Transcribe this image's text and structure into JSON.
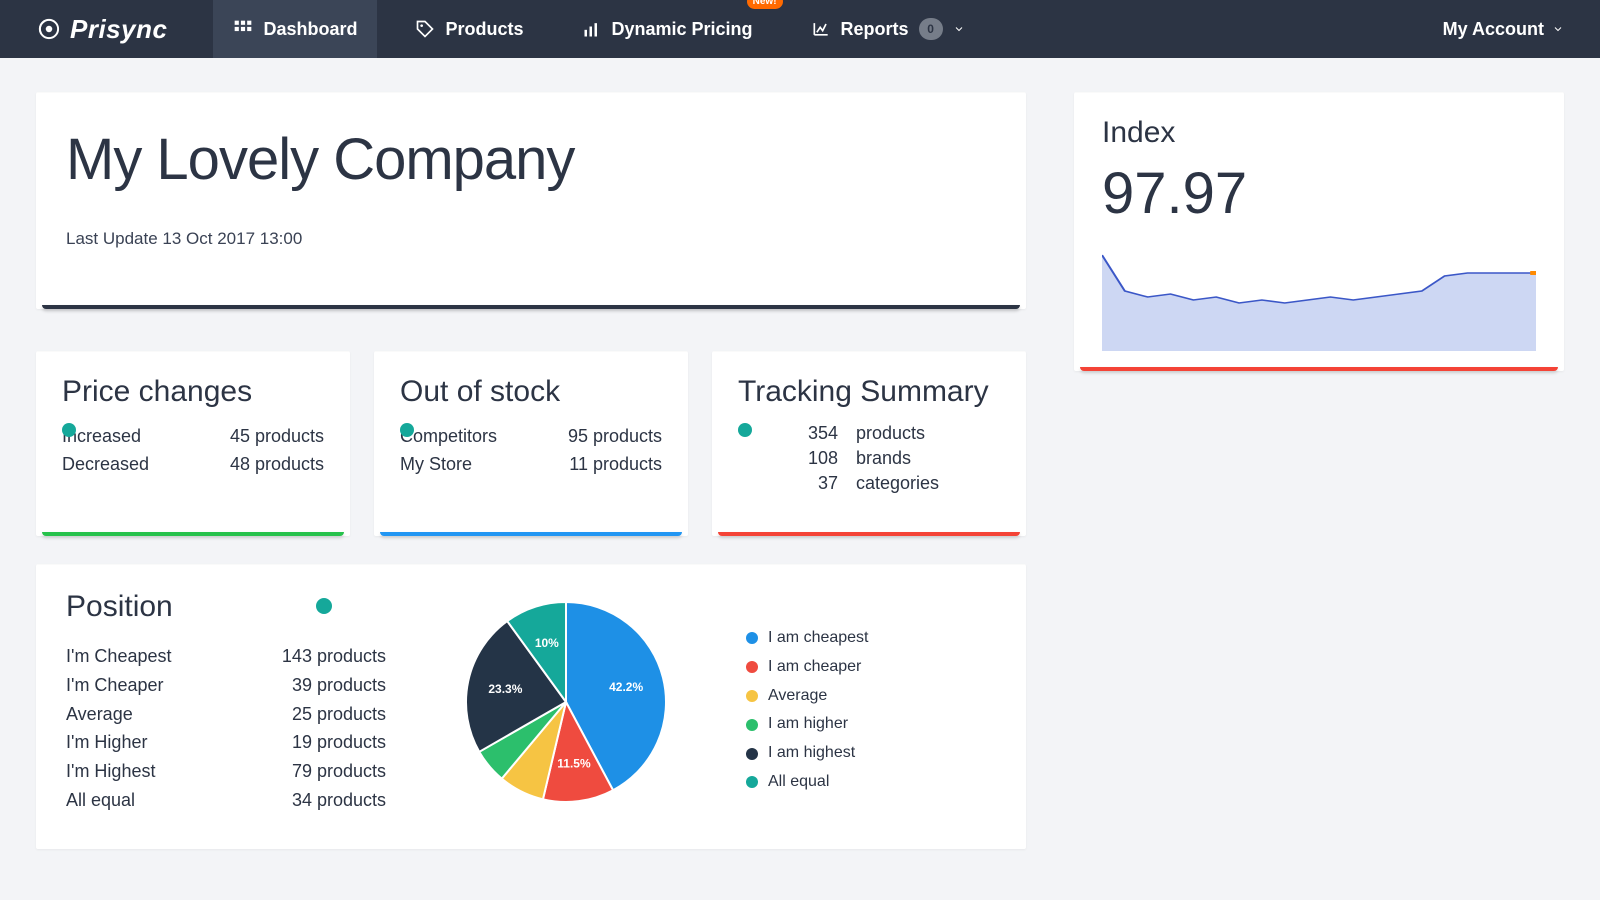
{
  "nav": {
    "brand": "Prisync",
    "items": [
      {
        "icon": "grid-icon",
        "label": "Dashboard",
        "active": true
      },
      {
        "icon": "tag-icon",
        "label": "Products"
      },
      {
        "icon": "bars-icon",
        "label": "Dynamic Pricing",
        "badge": "New!"
      },
      {
        "icon": "chart-icon",
        "label": "Reports",
        "count": "0",
        "caret": true
      }
    ],
    "account": "My Account"
  },
  "header": {
    "title": "My Lovely Company",
    "last_update": "Last Update 13 Oct 2017 13:00"
  },
  "price_changes": {
    "title": "Price changes",
    "rows": [
      {
        "label": "Increased",
        "value": "45 products"
      },
      {
        "label": "Decreased",
        "value": "48 products"
      }
    ]
  },
  "out_of_stock": {
    "title": "Out of stock",
    "rows": [
      {
        "label": "Competitors",
        "value": "95 products"
      },
      {
        "label": "My Store",
        "value": "11 products"
      }
    ]
  },
  "tracking_summary": {
    "title": "Tracking Summary",
    "rows": [
      {
        "n": "354",
        "label": "products"
      },
      {
        "n": "108",
        "label": "brands"
      },
      {
        "n": "37",
        "label": "categories"
      }
    ]
  },
  "position": {
    "title": "Position",
    "rows": [
      {
        "label": "I'm Cheapest",
        "value": "143 products"
      },
      {
        "label": "I'm Cheaper",
        "value": "39 products"
      },
      {
        "label": "Average",
        "value": "25 products"
      },
      {
        "label": "I'm Higher",
        "value": "19 products"
      },
      {
        "label": "I'm Highest",
        "value": "79 products"
      },
      {
        "label": "All equal",
        "value": "34 products"
      }
    ],
    "legend": [
      {
        "color": "#1e90e6",
        "label": "I am cheapest"
      },
      {
        "color": "#ef4b3f",
        "label": "I am cheaper"
      },
      {
        "color": "#f6c443",
        "label": "Average"
      },
      {
        "color": "#2cbf6c",
        "label": "I am higher"
      },
      {
        "color": "#243447",
        "label": "I am highest"
      },
      {
        "color": "#15a89a",
        "label": "All equal"
      }
    ]
  },
  "index": {
    "title": "Index",
    "value": "97.97"
  },
  "chart_data": [
    {
      "type": "pie",
      "title": "Position",
      "series": [
        {
          "name": "I am cheapest",
          "value": 42.2,
          "color": "#1e90e6"
        },
        {
          "name": "I am cheaper",
          "value": 11.5,
          "color": "#ef4b3f"
        },
        {
          "name": "Average",
          "value": 7.4,
          "color": "#f6c443"
        },
        {
          "name": "I am higher",
          "value": 5.6,
          "color": "#2cbf6c"
        },
        {
          "name": "I am highest",
          "value": 23.3,
          "color": "#243447"
        },
        {
          "name": "All equal",
          "value": 10.0,
          "color": "#15a89a"
        }
      ],
      "labels_visible": [
        "42.2%",
        "11.5%",
        "23.3%",
        "10%"
      ]
    },
    {
      "type": "area",
      "title": "Index",
      "ylim": [
        96,
        100
      ],
      "x": [
        0,
        1,
        2,
        3,
        4,
        5,
        6,
        7,
        8,
        9,
        10,
        11,
        12,
        13,
        14,
        15,
        16,
        17,
        18,
        19
      ],
      "values": [
        99.2,
        98.0,
        97.8,
        97.9,
        97.7,
        97.8,
        97.6,
        97.7,
        97.6,
        97.7,
        97.8,
        97.7,
        97.8,
        97.9,
        98.0,
        98.5,
        98.6,
        98.6,
        98.6,
        98.6
      ],
      "fill": "#cdd7f3",
      "stroke": "#3b57c7"
    }
  ]
}
